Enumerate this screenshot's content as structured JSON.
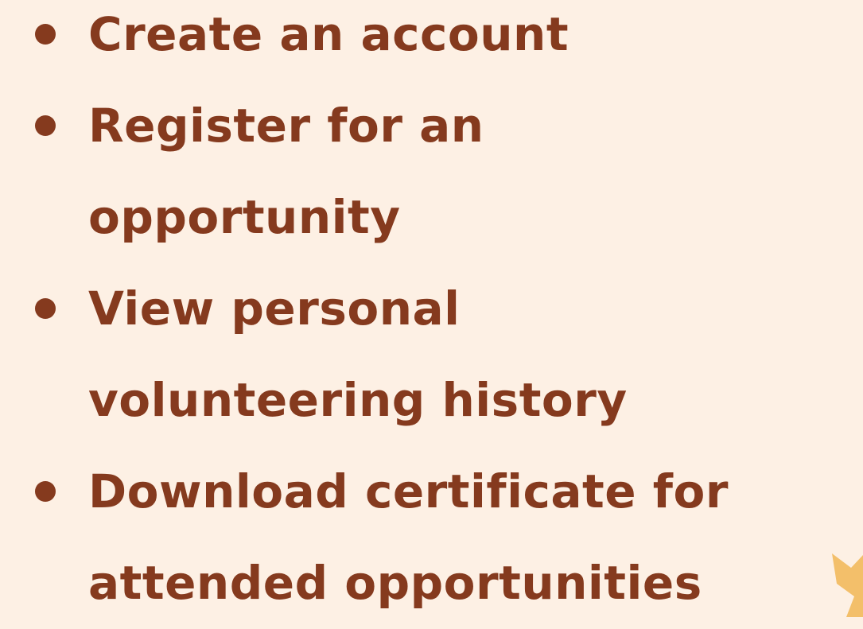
{
  "colors": {
    "background": "#fdf0e4",
    "text": "#853a1e",
    "accent_star": "#f3bf6a"
  },
  "list": {
    "items": [
      {
        "lines": [
          "Create an account"
        ]
      },
      {
        "lines": [
          "Register for an",
          "opportunity"
        ]
      },
      {
        "lines": [
          "View personal",
          "volunteering history"
        ]
      },
      {
        "lines": [
          "Download certificate for",
          "attended opportunities"
        ]
      }
    ]
  },
  "decoration": {
    "icon": "star-icon"
  }
}
